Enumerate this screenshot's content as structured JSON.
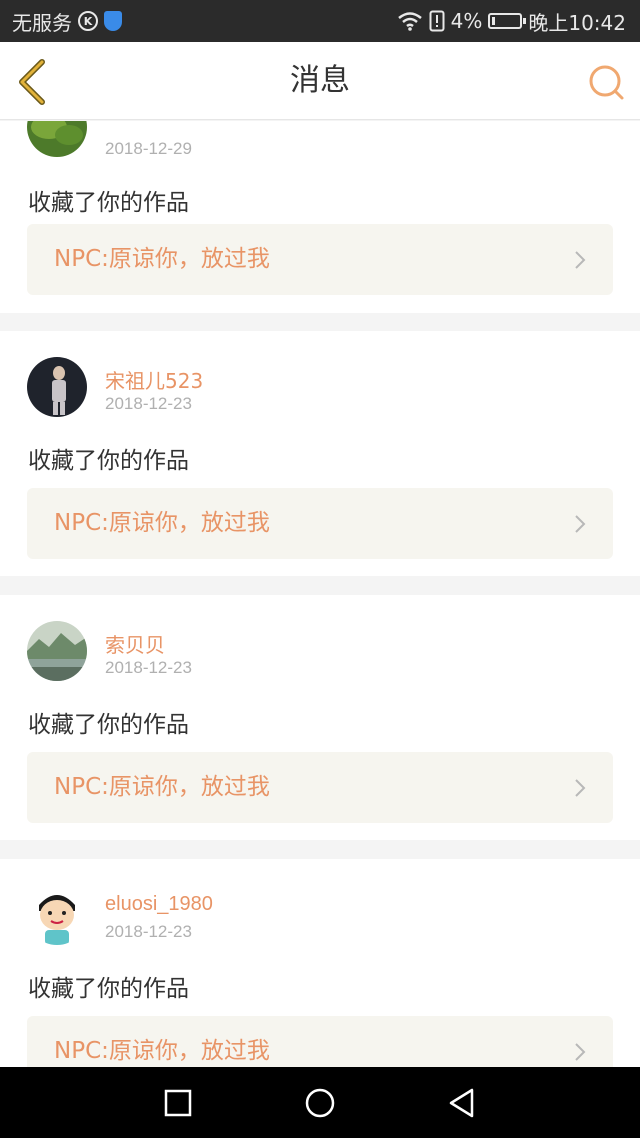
{
  "status_bar": {
    "carrier": "无服务",
    "k_icon": "K",
    "signal_icons": "wifi-icon, alert-icon",
    "battery_percent": "4%",
    "time": "晚上10:42"
  },
  "nav": {
    "title": "消息",
    "back_icon": "chevron-left-icon",
    "search_icon": "search-icon"
  },
  "colors": {
    "accent": "#e89466",
    "back_arrow": "#e2b23a",
    "link_bg": "#f6f5ef"
  },
  "messages": [
    {
      "username": "",
      "date": "2018-12-29",
      "action": "收藏了你的作品",
      "work_title": "NPC:原谅你，放过我",
      "avatar_icon": "leaf-photo"
    },
    {
      "username": "宋祖儿523",
      "date": "2018-12-23",
      "action": "收藏了你的作品",
      "work_title": "NPC:原谅你，放过我",
      "avatar_icon": "person-photo"
    },
    {
      "username": "索贝贝",
      "date": "2018-12-23",
      "action": "收藏了你的作品",
      "work_title": "NPC:原谅你，放过我",
      "avatar_icon": "landscape-photo"
    },
    {
      "username": "eluosi_1980",
      "date": "2018-12-23",
      "action": "收藏了你的作品",
      "work_title": "NPC:原谅你，放过我",
      "avatar_icon": "cartoon-boy"
    }
  ],
  "system_nav": {
    "recent_icon": "square-icon",
    "home_icon": "circle-icon",
    "back_icon": "triangle-back-icon"
  }
}
